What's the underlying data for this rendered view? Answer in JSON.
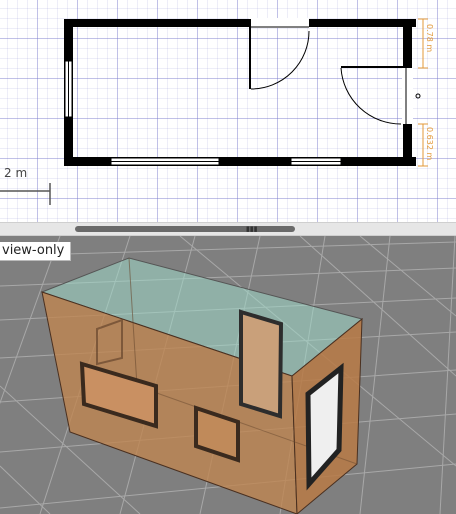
{
  "plan": {
    "scale_label": "2 m",
    "dimensions": [
      "0.78 m",
      "0.632 m"
    ]
  },
  "viewer": {
    "mode_label": "view-only"
  },
  "colors": {
    "wall": "#000000",
    "grid": "#b8b8e6",
    "dimension": "#e39a3a",
    "box_wall": "#c08550",
    "roof_glass": "#9ed8c8",
    "floor": "#7f7f7f"
  }
}
